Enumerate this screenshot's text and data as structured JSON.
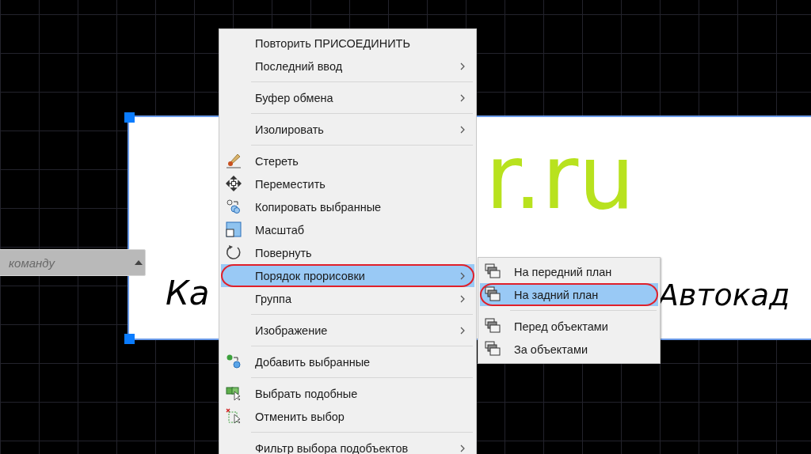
{
  "drawing": {
    "domain_text": "r.ru",
    "caption_left": "Ка",
    "caption_right": "Автокад"
  },
  "command_line": {
    "placeholder": "команду"
  },
  "context_menu": {
    "items": [
      {
        "kind": "command",
        "label": "Повторить ПРИСОЕДИНИТЬ",
        "submenu": false,
        "selected": false,
        "circled": false
      },
      {
        "kind": "command",
        "label": "Последний ввод",
        "submenu": true,
        "selected": false,
        "circled": false
      },
      {
        "kind": "separator"
      },
      {
        "kind": "command",
        "label": "Буфер обмена",
        "submenu": true,
        "selected": false,
        "circled": false
      },
      {
        "kind": "separator"
      },
      {
        "kind": "command",
        "label": "Изолировать",
        "submenu": true,
        "selected": false,
        "circled": false
      },
      {
        "kind": "separator"
      },
      {
        "kind": "command",
        "label": "Стереть",
        "submenu": false,
        "selected": false,
        "circled": false
      },
      {
        "kind": "command",
        "label": "Переместить",
        "submenu": false,
        "selected": false,
        "circled": false
      },
      {
        "kind": "command",
        "label": "Копировать выбранные",
        "submenu": false,
        "selected": false,
        "circled": false
      },
      {
        "kind": "command",
        "label": "Масштаб",
        "submenu": false,
        "selected": false,
        "circled": false
      },
      {
        "kind": "command",
        "label": "Повернуть",
        "submenu": false,
        "selected": false,
        "circled": false
      },
      {
        "kind": "command",
        "label": "Порядок прорисовки",
        "submenu": true,
        "selected": true,
        "circled": true
      },
      {
        "kind": "command",
        "label": "Группа",
        "submenu": true,
        "selected": false,
        "circled": false
      },
      {
        "kind": "separator"
      },
      {
        "kind": "command",
        "label": "Изображение",
        "submenu": true,
        "selected": false,
        "circled": false
      },
      {
        "kind": "separator"
      },
      {
        "kind": "command",
        "label": "Добавить выбранные",
        "submenu": false,
        "selected": false,
        "circled": false
      },
      {
        "kind": "separator"
      },
      {
        "kind": "command",
        "label": "Выбрать подобные",
        "submenu": false,
        "selected": false,
        "circled": false
      },
      {
        "kind": "command",
        "label": "Отменить выбор",
        "submenu": false,
        "selected": false,
        "circled": false
      },
      {
        "kind": "separator"
      },
      {
        "kind": "command",
        "label": "Фильтр выбора подобъектов",
        "submenu": true,
        "selected": false,
        "circled": false
      }
    ]
  },
  "submenu": {
    "items": [
      {
        "kind": "command",
        "label": "На передний план",
        "selected": false,
        "circled": false
      },
      {
        "kind": "command",
        "label": "На задний план",
        "selected": true,
        "circled": true
      },
      {
        "kind": "separator"
      },
      {
        "kind": "command",
        "label": "Перед объектами",
        "selected": false,
        "circled": false
      },
      {
        "kind": "command",
        "label": "За объектами",
        "selected": false,
        "circled": false
      }
    ]
  }
}
